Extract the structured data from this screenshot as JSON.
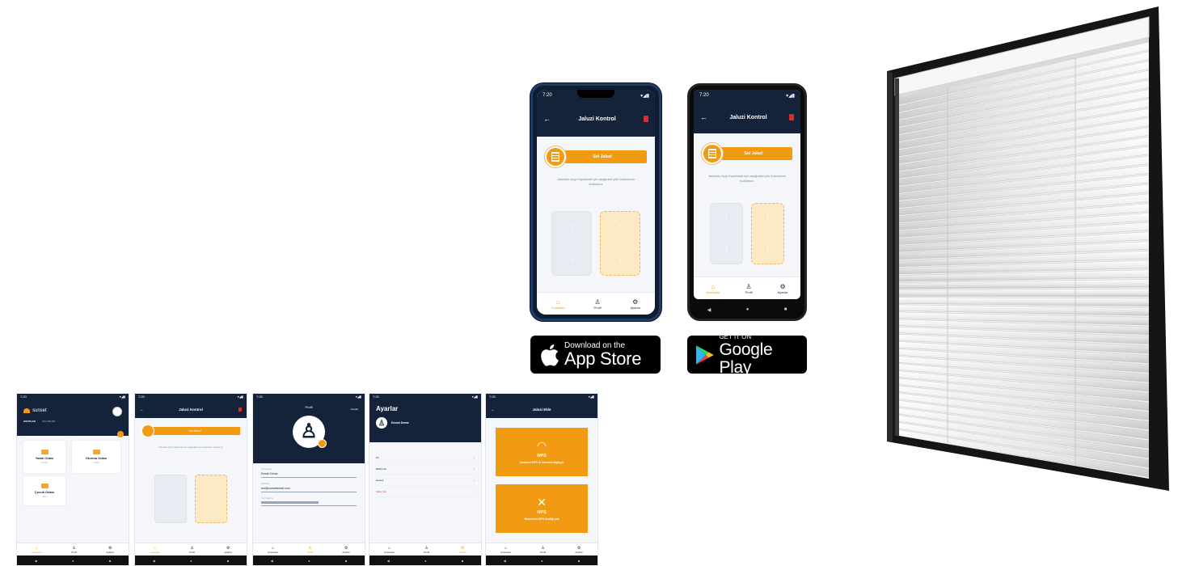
{
  "colors": {
    "navy": "#14233a",
    "orange": "#f29a12",
    "danger": "#d4302e",
    "frame": "#151515"
  },
  "phone_ios": {
    "status_time": "7:20",
    "status_icons": "▾◢▮",
    "title": "Jaluzi Kontrol",
    "button": "Sol Jaluzi",
    "hint": "Jaluzinin Açıp Kapatmak için aşağıdaki yön butonlarını kullanınız",
    "tabs": [
      "Anasayfa",
      "Profil",
      "Ayarlar"
    ]
  },
  "phone_android": {
    "status_time": "7:20",
    "status_icons": "▾◢▮",
    "title": "Jaluzi Kontrol",
    "button": "Sol Jaluzi",
    "hint": "Jaluzinin Açıp Kapatmak için aşağıdaki yön butonlarını kullanınız",
    "tabs": [
      "Anasayfa",
      "Profil",
      "Ayarlar"
    ]
  },
  "app_store": {
    "small": "Download on the",
    "big": "App Store"
  },
  "google_play": {
    "small": "GET IT ON",
    "big": "Google Play"
  },
  "strip": {
    "home": {
      "brand": "sunset",
      "tabs": [
        "GRUPLAR",
        "JALUZİLER"
      ],
      "rooms": [
        {
          "name": "Yatak Odası",
          "sub": "2/7 aktif"
        },
        {
          "name": "Oturma Odası",
          "sub": "4 aktif"
        },
        {
          "name": "Çocuk Odası",
          "sub": "Aktif"
        }
      ]
    },
    "control": {
      "title": "Jaluzi Kontrol",
      "button": "Sol Jaluzi",
      "hint": "Jaluzinin Açıp Kapatmak için aşağıdaki yön butonlarını kullanınız"
    },
    "profile": {
      "title": "Profil",
      "action": "Kaydet",
      "fields": [
        {
          "label": "Ad Soyadı",
          "value": "Emrah Demir"
        },
        {
          "label": "E-Posta",
          "value": "test@sunsetsmart.com"
        },
        {
          "label": "Yeni Telefon",
          "value": ""
        }
      ]
    },
    "settings": {
      "title": "Ayarlar",
      "user": "Emrah Demir",
      "rows": [
        "Dil",
        "Bildirimler",
        "Destek"
      ],
      "logout": "Çıkış Yap"
    },
    "add": {
      "title": "Jaluzi Ekle",
      "wps_title": "WPS",
      "wps_desc": "Jaluzinizi WPS ile internete bağlayın",
      "nowps_title": "WPS",
      "nowps_desc": "Modeminiz WPS özelliği yok"
    },
    "tabs": [
      "Anasayfa",
      "Profil",
      "Ayarlar"
    ]
  }
}
